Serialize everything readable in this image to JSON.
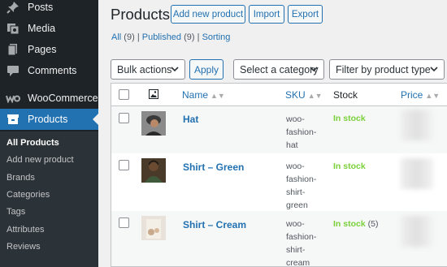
{
  "sidebar": {
    "items": [
      {
        "label": "Posts",
        "icon": "pushpin-icon"
      },
      {
        "label": "Media",
        "icon": "media-icon"
      },
      {
        "label": "Pages",
        "icon": "pages-icon"
      },
      {
        "label": "Comments",
        "icon": "comments-icon"
      },
      {
        "label": "WooCommerce",
        "icon": "woocommerce-icon"
      },
      {
        "label": "Products",
        "icon": "products-icon",
        "active": true
      }
    ],
    "submenu": [
      "All Products",
      "Add new product",
      "Brands",
      "Categories",
      "Tags",
      "Attributes",
      "Reviews"
    ]
  },
  "header": {
    "title": "Products",
    "buttons": [
      "Add new product",
      "Import",
      "Export"
    ]
  },
  "filters_links": {
    "all": "All",
    "all_count": "(9)",
    "sep1": "|",
    "published": "Published",
    "published_count": "(9)",
    "sep2": "|",
    "sorting": "Sorting"
  },
  "toolbar": {
    "bulk_actions": "Bulk actions",
    "apply": "Apply",
    "category": "Select a category",
    "product_type": "Filter by product type"
  },
  "table": {
    "columns": {
      "name": "Name",
      "sku": "SKU",
      "stock": "Stock",
      "price": "Price"
    },
    "rows": [
      {
        "name": "Hat",
        "sku_lines": [
          "woo-",
          "fashion-",
          "hat"
        ],
        "stock": "In stock",
        "qty": ""
      },
      {
        "name": "Shirt – Green",
        "sku_lines": [
          "woo-",
          "fashion-",
          "shirt-",
          "green"
        ],
        "stock": "In stock",
        "qty": ""
      },
      {
        "name": "Shirt – Cream",
        "sku_lines": [
          "woo-",
          "fashion-",
          "shirt-",
          "cream"
        ],
        "stock": "In stock",
        "qty": "(5)"
      }
    ]
  },
  "colors": {
    "accent": "#2271b1",
    "sidebar": "#1d2327",
    "in_stock": "#7ad03a"
  }
}
